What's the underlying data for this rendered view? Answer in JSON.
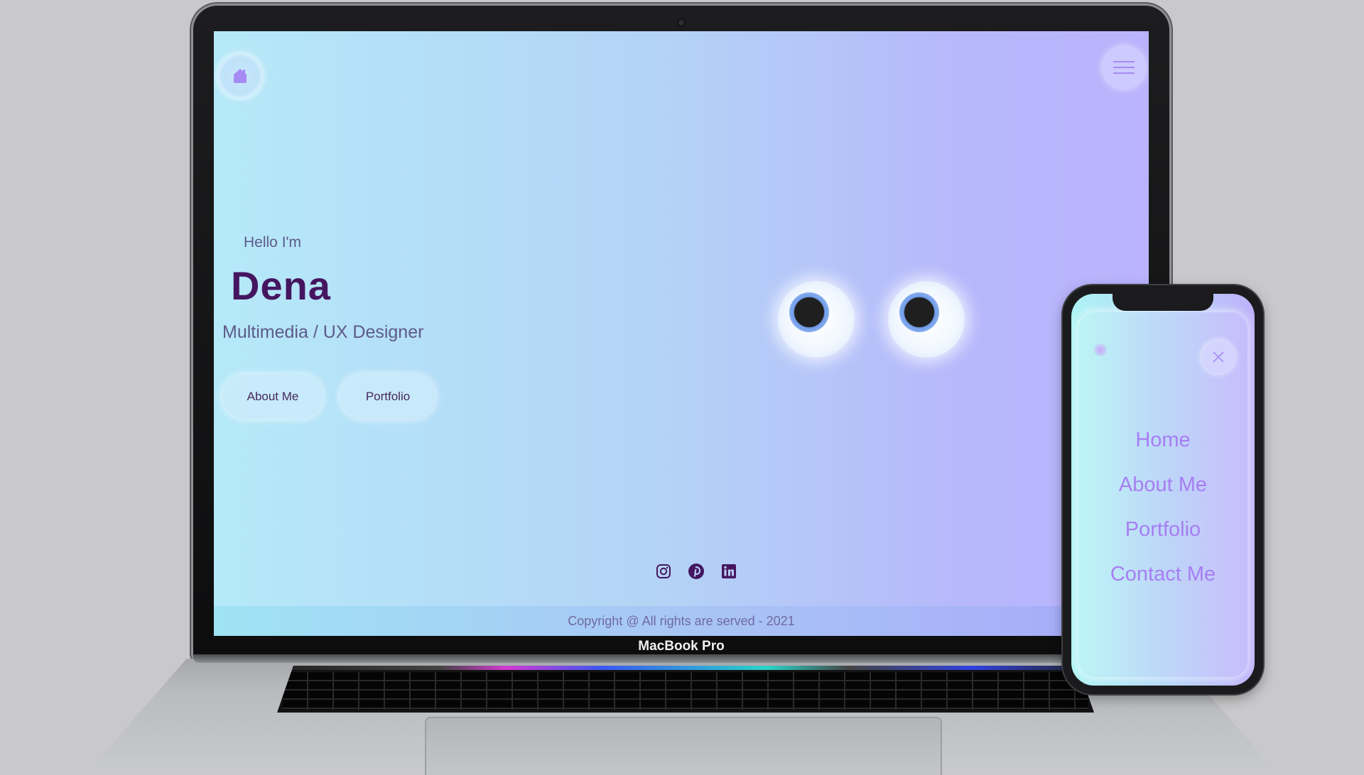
{
  "laptop": {
    "label": "MacBook Pro"
  },
  "site": {
    "logo_icon": "house-icon",
    "menu_icon": "hamburger-menu-icon",
    "hero": {
      "greeting": "Hello I'm",
      "name": "Dena",
      "role": "Multimedia / UX Designer",
      "buttons": [
        {
          "label": "About Me"
        },
        {
          "label": "Portfolio"
        }
      ]
    },
    "socials": [
      {
        "icon": "instagram-icon"
      },
      {
        "icon": "pinterest-icon"
      },
      {
        "icon": "linkedin-icon"
      }
    ],
    "footer": "Copyright @ All rights are served - 2021"
  },
  "phone": {
    "close_icon": "close-icon",
    "nav": [
      {
        "label": "Home"
      },
      {
        "label": "About Me"
      },
      {
        "label": "Portfolio"
      },
      {
        "label": "Contact Me"
      }
    ]
  },
  "colors": {
    "accent_purple": "#a77ef3",
    "name_color": "#45165f",
    "text_muted": "#5d5a8a"
  }
}
